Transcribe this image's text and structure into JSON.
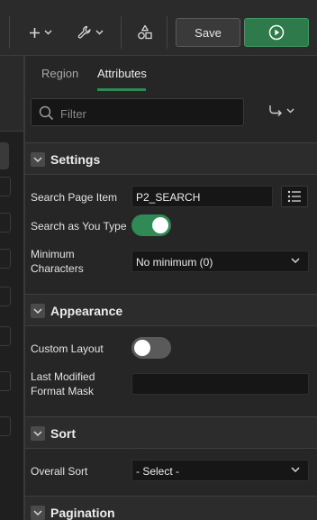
{
  "toolbar": {
    "add_icon": "plus-icon",
    "utilities_icon": "wrench-icon",
    "shared_components_icon": "shapes-icon",
    "save_label": "Save",
    "run_icon": "play-icon",
    "colors": {
      "run_button": "#2e7a4b"
    }
  },
  "tabs": [
    {
      "label": "Region",
      "active": false
    },
    {
      "label": "Attributes",
      "active": true
    }
  ],
  "filter": {
    "placeholder": "Filter"
  },
  "sections": {
    "settings": {
      "title": "Settings",
      "search_page_item": {
        "label": "Search Page Item",
        "value": "P2_SEARCH"
      },
      "search_as_you_type": {
        "label": "Search as You Type",
        "on": true
      },
      "minimum_characters": {
        "label": "Minimum Characters",
        "value": "No minimum (0)"
      }
    },
    "appearance": {
      "title": "Appearance",
      "custom_layout": {
        "label": "Custom Layout",
        "on": false
      },
      "last_modified": {
        "label": "Last Modified Format Mask",
        "value": ""
      }
    },
    "sort": {
      "title": "Sort",
      "overall_sort": {
        "label": "Overall Sort",
        "value": "- Select -"
      }
    },
    "pagination": {
      "title": "Pagination"
    }
  }
}
